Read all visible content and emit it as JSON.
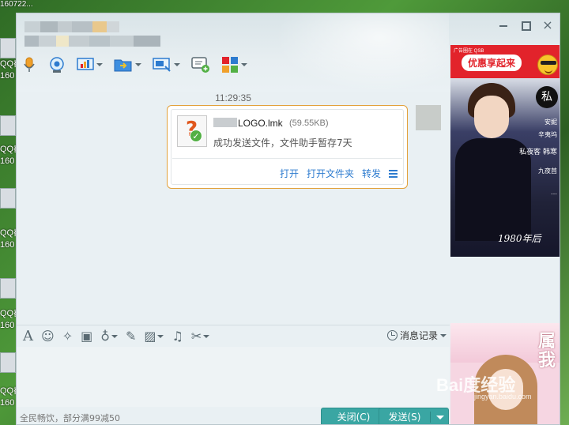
{
  "desktop": {
    "top_label": "160722...",
    "items": [
      {
        "line1": "QQ截",
        "line2": "160"
      },
      {
        "line1": "QQ截",
        "line2": "160"
      },
      {
        "line1": "QQ截",
        "line2": "160"
      },
      {
        "line1": "QQ截",
        "line2": "160"
      },
      {
        "line1": "QQ截",
        "line2": "160"
      }
    ]
  },
  "window": {
    "controls": {
      "minimize": "minimize",
      "maximize": "maximize",
      "close": "×"
    },
    "toolbar": [
      "voice-call-icon",
      "video-call-icon",
      "remote-desktop-icon",
      "file-transfer-icon",
      "screen-share-icon",
      "message-add-icon",
      "apps-icon"
    ]
  },
  "chat": {
    "timestamp": "11:29:35",
    "file": {
      "name": "LOGO.lmk",
      "size": "(59.55KB)",
      "status": "成功发送文件，文件助手暂存7天",
      "icon_glyph": "?",
      "check_glyph": "✓"
    },
    "actions": {
      "open": "打开",
      "open_folder": "打开文件夹",
      "forward": "转发"
    }
  },
  "input_toolbar": {
    "icons": [
      "font-icon",
      "emoji-icon",
      "poke-icon",
      "video-msg-icon",
      "voice-msg-icon",
      "edit-icon",
      "image-icon",
      "music-icon",
      "screenshot-icon"
    ],
    "glyphs": {
      "font": "A",
      "emoji": "☺",
      "poke": "✧",
      "video": "▣",
      "voice": "♁",
      "edit": "✎",
      "image": "▨",
      "music": "♫",
      "cut": "✂"
    },
    "history_label": "消息记录"
  },
  "footer": {
    "promo_text": "全民畅饮，部分满99减50",
    "close_button": "关闭(C)",
    "send_button": "发送(S)"
  },
  "ads": {
    "top_tiny": "广告圈在 QSB",
    "top_label": "优惠享起来",
    "main_circle": "私",
    "main_lines": [
      "安妮",
      "辛夷坞",
      "私夜客 韩寒",
      "九夜茴",
      "…"
    ],
    "main_big": "1980年后",
    "bottom_chars": "属\n我"
  },
  "watermark": {
    "text": "Bai度经验",
    "sub": "jingyan.baidu.com"
  }
}
